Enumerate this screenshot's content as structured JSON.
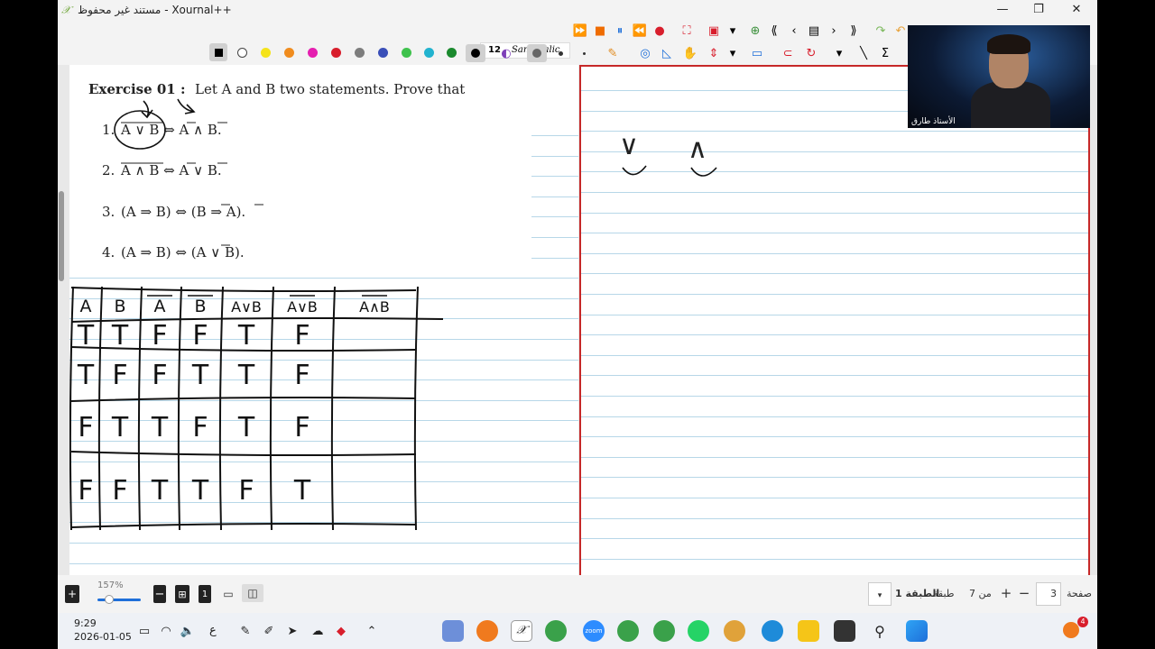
{
  "window": {
    "title": "مستند غير محفوظ - Xournal++",
    "controls": {
      "minimize": "—",
      "maximize": "❐",
      "close": "✕"
    }
  },
  "toolbar": {
    "font_size": "12",
    "font_name": "Sans Italic",
    "pen_colors": [
      "#000000",
      "#ffffff",
      "#f5e31a",
      "#f08c1e",
      "#e51fb0",
      "#d81e2c",
      "#7d7d7d",
      "#3a4fb8",
      "#3fc24d",
      "#22b3cf",
      "#1b8a2e",
      "#000000"
    ]
  },
  "document": {
    "exercise_heading": "Exercise 01 :",
    "exercise_intro": "Let A and B two statements. Prove that",
    "items": [
      {
        "num": "1.",
        "text": "A ∨ B ⇔ A ∧ B."
      },
      {
        "num": "2.",
        "text": "A ∧ B ⇔ A ∨ B."
      },
      {
        "num": "3.",
        "text": "(A ⇒ B) ⇔ (B ⇒ A)."
      },
      {
        "num": "4.",
        "text": "(A ⇒ B) ⇔ (A ∨ B)."
      }
    ],
    "truth_table": {
      "headers": [
        "A",
        "B",
        "A",
        "B",
        "A∨B",
        "A∨B",
        "A∧B"
      ],
      "rows": [
        [
          "T",
          "T",
          "F",
          "F",
          "T",
          "F",
          ""
        ],
        [
          "T",
          "F",
          "F",
          "T",
          "T",
          "F",
          ""
        ],
        [
          "F",
          "T",
          "T",
          "F",
          "T",
          "F",
          ""
        ],
        [
          "F",
          "F",
          "T",
          "T",
          "F",
          "T",
          ""
        ]
      ]
    },
    "right_page_symbols": [
      "∨",
      "∧"
    ]
  },
  "webcam": {
    "caption": "الأستاذ طارق"
  },
  "statusbar": {
    "zoom": "157%",
    "page_label": "صفحة",
    "page_number": "3",
    "of_label": "من 7",
    "layer_label": "طبقة",
    "layer_value": "الطبقة 1"
  },
  "taskbar": {
    "time": "9:29",
    "date": "2026-01-05",
    "lang": "ع",
    "notification_count": "4"
  }
}
